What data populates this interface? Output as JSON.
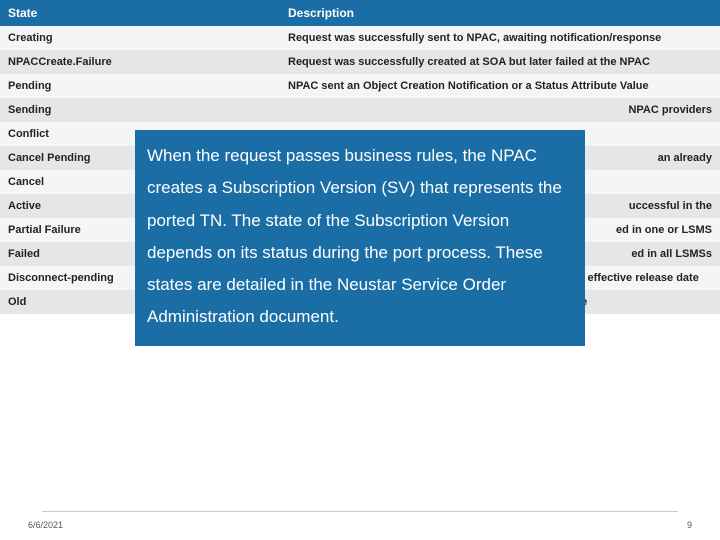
{
  "table": {
    "headers": [
      "State",
      "Description"
    ],
    "rows": [
      {
        "state": "Creating",
        "desc": "Request was successfully sent to NPAC, awaiting notification/response"
      },
      {
        "state": "NPACCreate.Failure",
        "desc": "Request was successfully created at SOA but later failed at the NPAC"
      },
      {
        "state": "Pending",
        "desc": "NPAC sent an Object Creation Notification or a Status Attribute Value"
      },
      {
        "state": "Sending",
        "desc": "NPAC providers"
      },
      {
        "state": "Conflict",
        "desc": ""
      },
      {
        "state": "Cancel Pending",
        "desc": "an already"
      },
      {
        "state": "Cancel",
        "desc": ""
      },
      {
        "state": "Active",
        "desc": "uccessful in the"
      },
      {
        "state": "Partial Failure",
        "desc": "ed in one or LSMS"
      },
      {
        "state": "Failed",
        "desc": "ed in all LSMSs"
      },
      {
        "state": "Disconnect-pending",
        "desc": "Disconnect request was sent for an active SV with future effective release date"
      },
      {
        "state": "Old",
        "desc": "Notification received from NPAC for disconnect complete"
      }
    ]
  },
  "overlay_text": "When the request passes business rules, the NPAC creates a Subscription Version (SV) that represents the ported TN.\nThe state of the Subscription Version depends on its status during the port process.\nThese states are detailed in the Neustar Service Order Administration document.",
  "footer": {
    "date": "6/6/2021",
    "page": "9"
  }
}
